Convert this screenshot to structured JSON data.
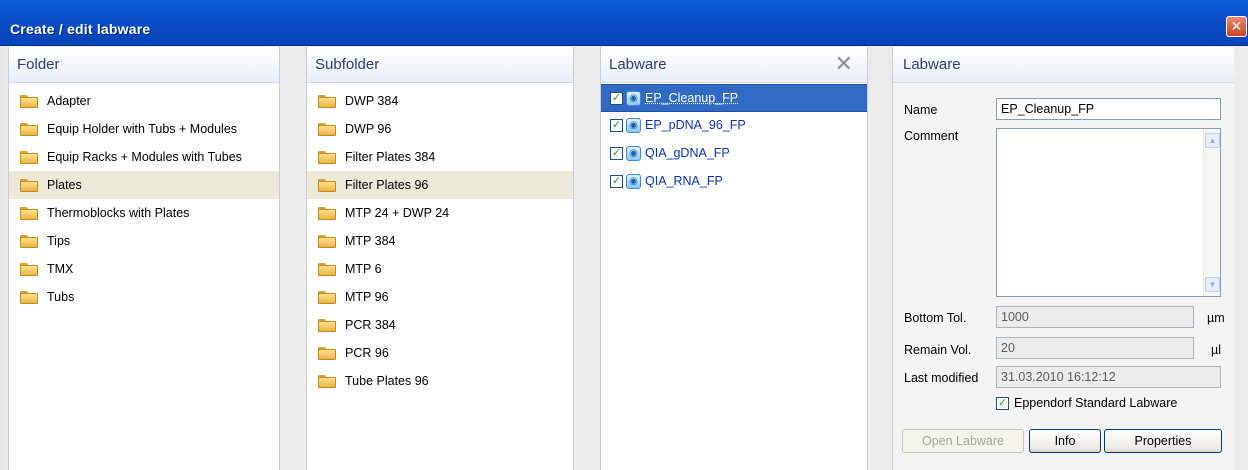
{
  "window": {
    "title": "Create / edit labware",
    "close_glyph": "✕"
  },
  "folder_panel": {
    "header": "Folder",
    "items": [
      {
        "label": "Adapter",
        "selected": false
      },
      {
        "label": "Equip Holder with Tubs + Modules",
        "selected": false
      },
      {
        "label": "Equip Racks + Modules with Tubes",
        "selected": false
      },
      {
        "label": "Plates",
        "selected": true
      },
      {
        "label": "Thermoblocks with Plates",
        "selected": false
      },
      {
        "label": "Tips",
        "selected": false
      },
      {
        "label": "TMX",
        "selected": false
      },
      {
        "label": "Tubs",
        "selected": false
      }
    ]
  },
  "subfolder_panel": {
    "header": "Subfolder",
    "items": [
      {
        "label": "DWP 384",
        "selected": false
      },
      {
        "label": "DWP 96",
        "selected": false
      },
      {
        "label": "Filter Plates 384",
        "selected": false
      },
      {
        "label": "Filter Plates 96",
        "selected": true
      },
      {
        "label": "MTP 24 + DWP 24",
        "selected": false
      },
      {
        "label": "MTP 384",
        "selected": false
      },
      {
        "label": "MTP 6",
        "selected": false
      },
      {
        "label": "MTP 96",
        "selected": false
      },
      {
        "label": "PCR 384",
        "selected": false
      },
      {
        "label": "PCR 96",
        "selected": false
      },
      {
        "label": "Tube Plates 96",
        "selected": false
      }
    ]
  },
  "labware_list_panel": {
    "header": "Labware",
    "close_glyph": "✕",
    "items": [
      {
        "label": "EP_Cleanup_FP",
        "checked": true,
        "selected": true
      },
      {
        "label": "EP_pDNA_96_FP",
        "checked": true,
        "selected": false
      },
      {
        "label": "QIA_gDNA_FP",
        "checked": true,
        "selected": false
      },
      {
        "label": "QIA_RNA_FP",
        "checked": true,
        "selected": false
      }
    ]
  },
  "labware_props": {
    "header": "Labware",
    "name_label": "Name",
    "name_value": "EP_Cleanup_FP",
    "comment_label": "Comment",
    "comment_value": "",
    "bottom_tol_label": "Bottom Tol.",
    "bottom_tol_value": "1000",
    "bottom_tol_unit": "µm",
    "remain_vol_label": "Remain Vol.",
    "remain_vol_value": "20",
    "remain_vol_unit": "µl",
    "last_modified_label": "Last modified",
    "last_modified_value": "31.03.2010 16:12:12",
    "standard_label": "Eppendorf Standard Labware",
    "standard_checked": true,
    "open_button": "Open Labware",
    "info_button": "Info",
    "properties_button": "Properties",
    "check_glyph": "✓",
    "scroll_up_glyph": "▲",
    "scroll_down_glyph": "▼"
  },
  "colors": {
    "titlebar": "#0a4ec9",
    "selection_list": "#316ac5",
    "selection_folder": "#ece9d8",
    "header_text": "#2b3e6d",
    "labware_link": "#0d2fb8"
  }
}
